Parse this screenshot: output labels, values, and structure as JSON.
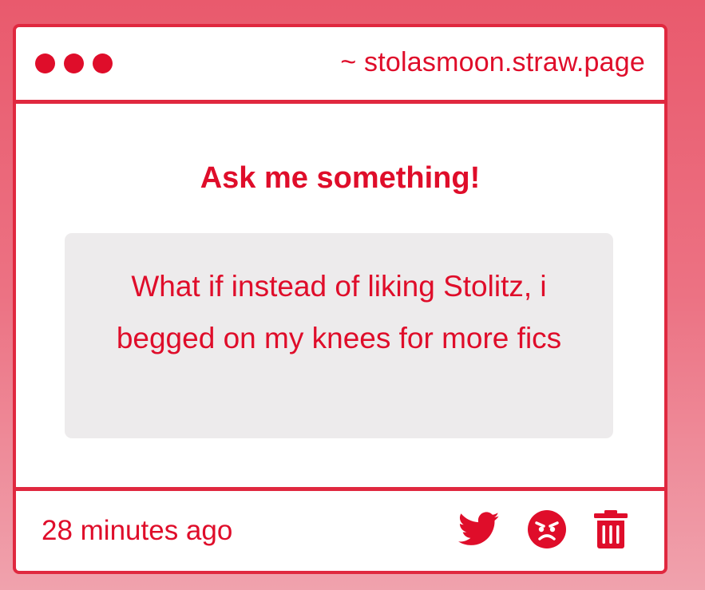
{
  "window": {
    "url": "~ stolasmoon.straw.page"
  },
  "main": {
    "heading": "Ask me something!",
    "question": "What if instead of liking Stolitz, i begged on my knees for more fics"
  },
  "footer": {
    "timestamp": "28 minutes ago",
    "actions": [
      "twitter-icon",
      "angry-face-icon",
      "trash-icon"
    ]
  },
  "colors": {
    "accent": "#df0d2a",
    "border": "#e0283f",
    "question_bg": "#edebec"
  }
}
